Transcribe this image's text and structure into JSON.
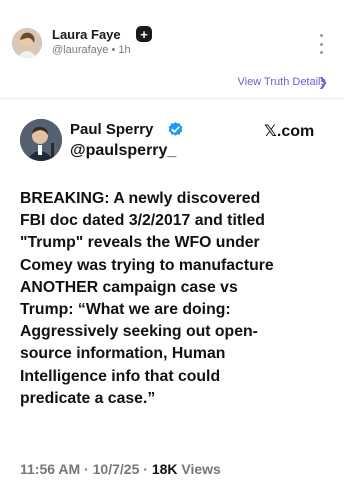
{
  "post": {
    "author_name": "Laura Faye",
    "author_handle": "@laurafaye",
    "separator": "•",
    "time_ago": "1h",
    "details_link": "View Truth Details",
    "icons": {
      "badge": "plus-badge-icon",
      "menu": "more-vertical-icon",
      "chevron": "chevron-right-icon"
    }
  },
  "quoted": {
    "name": "Paul Sperry",
    "handle": "@paulsperry_",
    "platform": "𝕏.com",
    "verified_color": "#1d9bf0",
    "body": "BREAKING: A newly discovered\nFBI doc dated 3/2/2017 and titled\n\"Trump\" reveals the WFO under\nComey was trying to manufacture\nANOTHER campaign case vs\nTrump: “What we are doing:\nAggressively seeking out open-\nsource information, Human\nIntelligence info that could\npredicate a case.”",
    "time": "11:56 AM",
    "dot": "·",
    "date": "10/7/25",
    "views_count": "18K",
    "views_label": "Views"
  },
  "colors": {
    "link": "#6a5fd6",
    "muted": "#777777",
    "text": "#111111"
  }
}
